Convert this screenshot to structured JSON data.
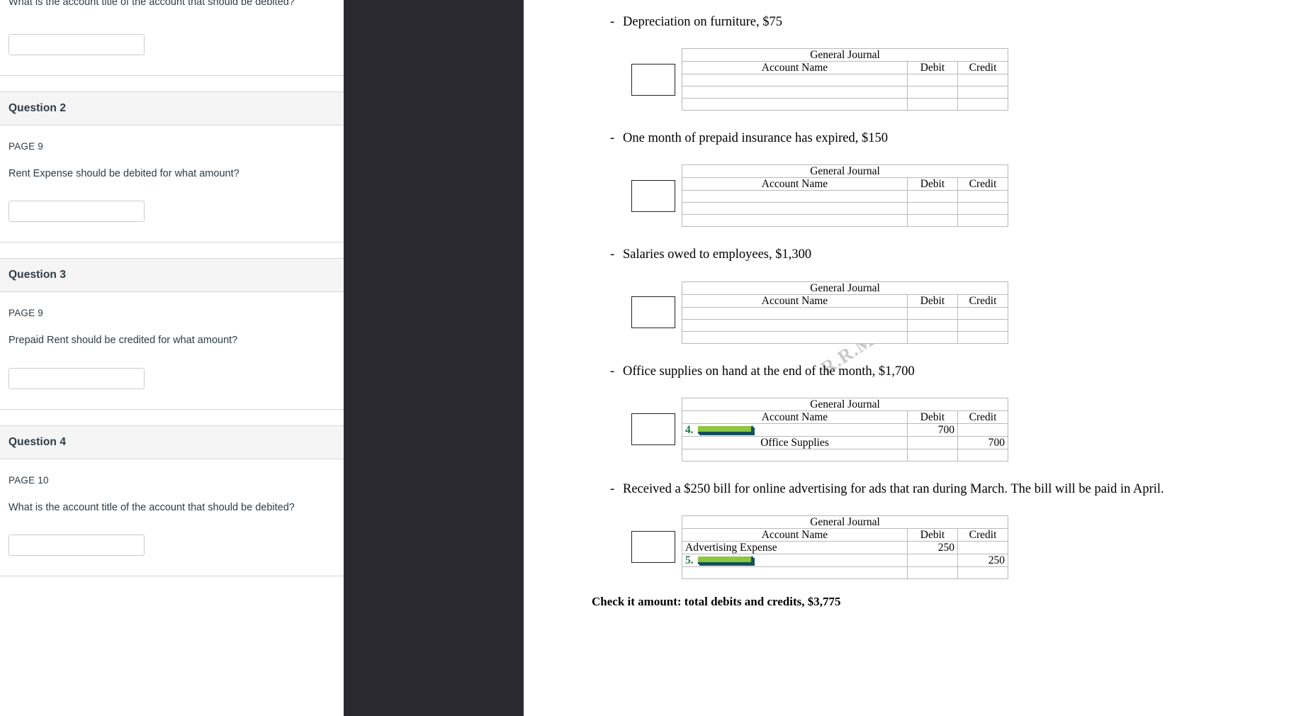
{
  "quiz": {
    "partial_top_question": {
      "text": "What is the account title of the account that should be debited?",
      "input_value": "",
      "input_placeholder": ""
    },
    "questions": [
      {
        "header": "Question 2",
        "page": "PAGE 9",
        "text": "Rent Expense should be debited for what amount?",
        "input_value": "",
        "input_placeholder": ""
      },
      {
        "header": "Question 3",
        "page": "PAGE 9",
        "text": "Prepaid Rent should be credited for what amount?",
        "input_value": "",
        "input_placeholder": ""
      },
      {
        "header": "Question 4",
        "page": "PAGE 10",
        "text": "What is the account title of the account that should be debited?",
        "input_value": "",
        "input_placeholder": ""
      }
    ]
  },
  "document": {
    "journal_title": "General Journal",
    "columns": {
      "account": "Account Name",
      "debit": "Debit",
      "credit": "Credit"
    },
    "watermarks": [
      "R.R.M.",
      "R.R.M."
    ],
    "check_line": "Check it amount: total debits and credits, $3,775",
    "entries": [
      {
        "bullet_dash": "-",
        "bullet_text": "Depreciation on furniture, $75",
        "rows": [
          {
            "num": "",
            "account": "",
            "debit": "",
            "credit": "",
            "highlight": false
          },
          {
            "num": "",
            "account": "",
            "debit": "",
            "credit": "",
            "highlight": false
          },
          {
            "num": "",
            "account": "",
            "debit": "",
            "credit": "",
            "highlight": false
          }
        ]
      },
      {
        "bullet_dash": "-",
        "bullet_text": "One month of prepaid insurance has expired, $150",
        "rows": [
          {
            "num": "",
            "account": "",
            "debit": "",
            "credit": "",
            "highlight": false
          },
          {
            "num": "",
            "account": "",
            "debit": "",
            "credit": "",
            "highlight": false
          },
          {
            "num": "",
            "account": "",
            "debit": "",
            "credit": "",
            "highlight": false
          }
        ]
      },
      {
        "bullet_dash": "-",
        "bullet_text": "Salaries owed to employees, $1,300",
        "rows": [
          {
            "num": "",
            "account": "",
            "debit": "",
            "credit": "",
            "highlight": false
          },
          {
            "num": "",
            "account": "",
            "debit": "",
            "credit": "",
            "highlight": false
          },
          {
            "num": "",
            "account": "",
            "debit": "",
            "credit": "",
            "highlight": false
          }
        ]
      },
      {
        "bullet_dash": "-",
        "bullet_text": "Office supplies on hand at the end of the month, $1,700",
        "rows": [
          {
            "num": "4.",
            "account": "",
            "debit": "700",
            "credit": "",
            "highlight": true
          },
          {
            "num": "",
            "account": "Office Supplies",
            "debit": "",
            "credit": "700",
            "highlight": false
          },
          {
            "num": "",
            "account": "",
            "debit": "",
            "credit": "",
            "highlight": false
          }
        ]
      },
      {
        "bullet_dash": "-",
        "bullet_text": "Received a $250 bill for online advertising for ads that ran during March. The bill will be paid in April.",
        "rows": [
          {
            "num": "",
            "account": "Advertising Expense",
            "debit": "250",
            "credit": "",
            "highlight": false,
            "align": "left"
          },
          {
            "num": "5.",
            "account": "",
            "debit": "",
            "credit": "250",
            "highlight": true
          },
          {
            "num": "",
            "account": "",
            "debit": "",
            "credit": "",
            "highlight": false
          }
        ]
      }
    ]
  }
}
